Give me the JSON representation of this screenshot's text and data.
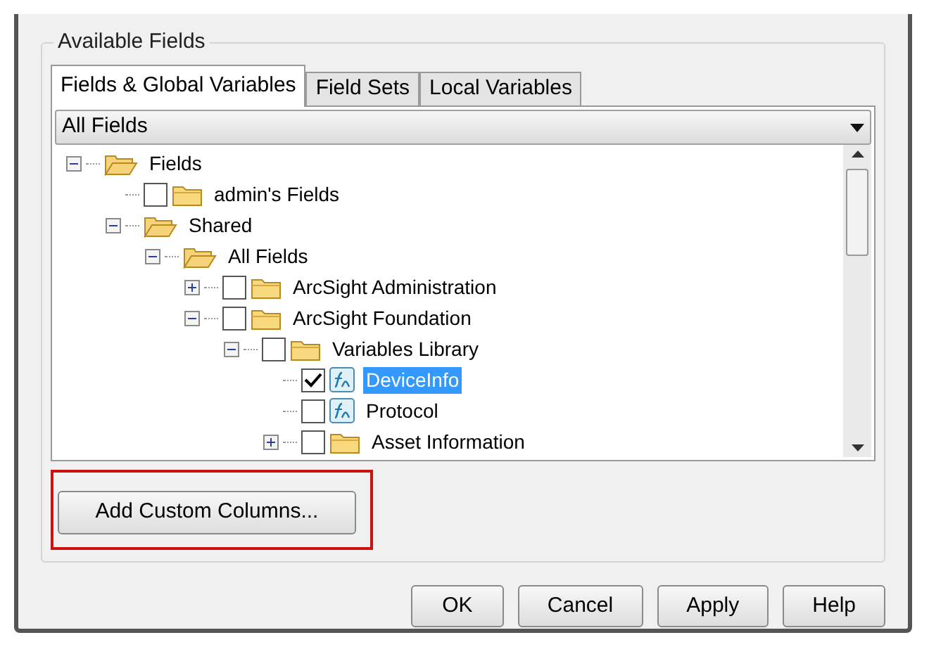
{
  "group_title": "Available Fields",
  "tabs": [
    {
      "label": "Fields & Global Variables",
      "selected": true
    },
    {
      "label": "Field Sets",
      "selected": false
    },
    {
      "label": "Local Variables",
      "selected": false
    }
  ],
  "filter": {
    "value": "All Fields"
  },
  "tree": [
    {
      "label": "Fields",
      "kind": "group",
      "expanded": true,
      "selected": false,
      "children": [
        {
          "label": "admin's Fields",
          "kind": "folder",
          "checked": false,
          "selected": false
        },
        {
          "label": "Shared",
          "kind": "group",
          "expanded": true,
          "selected": false,
          "children": [
            {
              "label": "All Fields",
              "kind": "group",
              "expanded": true,
              "selected": false,
              "children": [
                {
                  "label": "ArcSight Administration",
                  "kind": "folder",
                  "checked": false,
                  "expanded": false,
                  "selected": false
                },
                {
                  "label": "ArcSight Foundation",
                  "kind": "folder",
                  "checked": false,
                  "expanded": true,
                  "selected": false,
                  "children": [
                    {
                      "label": "Variables Library",
                      "kind": "folder",
                      "checked": false,
                      "expanded": true,
                      "selected": false,
                      "children": [
                        {
                          "label": "DeviceInfo",
                          "kind": "variable",
                          "checked": true,
                          "selected": true
                        },
                        {
                          "label": "Protocol",
                          "kind": "variable",
                          "checked": false,
                          "selected": false
                        },
                        {
                          "label": "Asset Information",
                          "kind": "folder",
                          "checked": false,
                          "expanded": false,
                          "selected": false
                        }
                      ]
                    }
                  ]
                }
              ]
            }
          ]
        }
      ]
    }
  ],
  "add_button": {
    "label": "Add Custom Columns...",
    "highlighted": true
  },
  "buttons": [
    "OK",
    "Cancel",
    "Apply",
    "Help"
  ]
}
